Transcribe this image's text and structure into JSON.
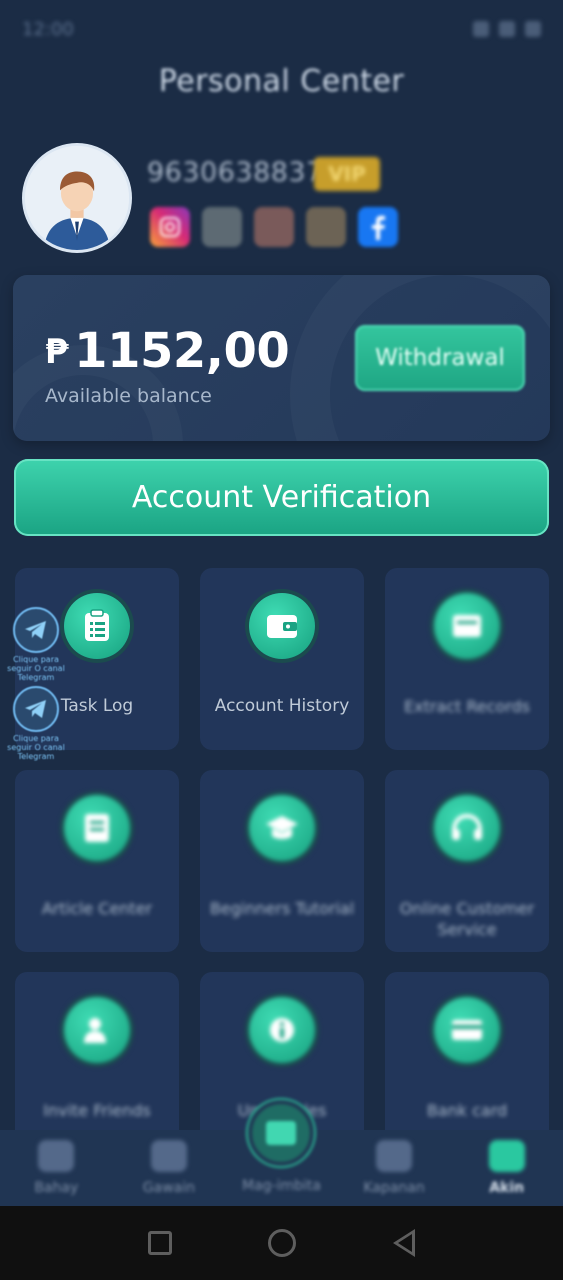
{
  "status_bar": {
    "time": "12:00"
  },
  "header": {
    "title": "Personal Center"
  },
  "profile": {
    "user_id": "9630638837",
    "vip_label": "VIP",
    "social_icons": [
      "instagram-icon",
      "x-icon",
      "social-icon-3",
      "social-icon-4",
      "facebook-icon"
    ]
  },
  "balance": {
    "currency": "₱",
    "amount": "1152,00",
    "label": "Available balance",
    "withdraw_label": "Withdrawal"
  },
  "verify_label": "Account Verification",
  "telegram_float": {
    "text": "Clique para seguir O canal Telegram"
  },
  "grid": [
    {
      "label": "Task Log",
      "icon": "clipboard-icon"
    },
    {
      "label": "Account History",
      "icon": "wallet-icon"
    },
    {
      "label": "Extract Records",
      "icon": "receipt-icon"
    },
    {
      "label": "Article Center",
      "icon": "article-icon"
    },
    {
      "label": "Beginners Tutorial",
      "icon": "graduation-cap-icon"
    },
    {
      "label": "Online Customer Service",
      "icon": "headset-icon"
    },
    {
      "label": "Invite Friends",
      "icon": "add-user-icon"
    },
    {
      "label": "Unc... ...les",
      "icon": "info-icon"
    },
    {
      "label": "Bank card",
      "icon": "bank-card-icon"
    }
  ],
  "bottom_nav": [
    {
      "label": "Bahay",
      "icon": "home-icon"
    },
    {
      "label": "Gawain",
      "icon": "tasks-icon"
    },
    {
      "label": "Mag-imbita",
      "icon": "invite-icon"
    },
    {
      "label": "Kapanan",
      "icon": "team-icon"
    },
    {
      "label": "Akin",
      "icon": "user-icon"
    }
  ],
  "colors": {
    "background": "#1b2c45",
    "accent": "#2ac8a0",
    "card": "#22365a",
    "vip": "#c79e2b"
  }
}
